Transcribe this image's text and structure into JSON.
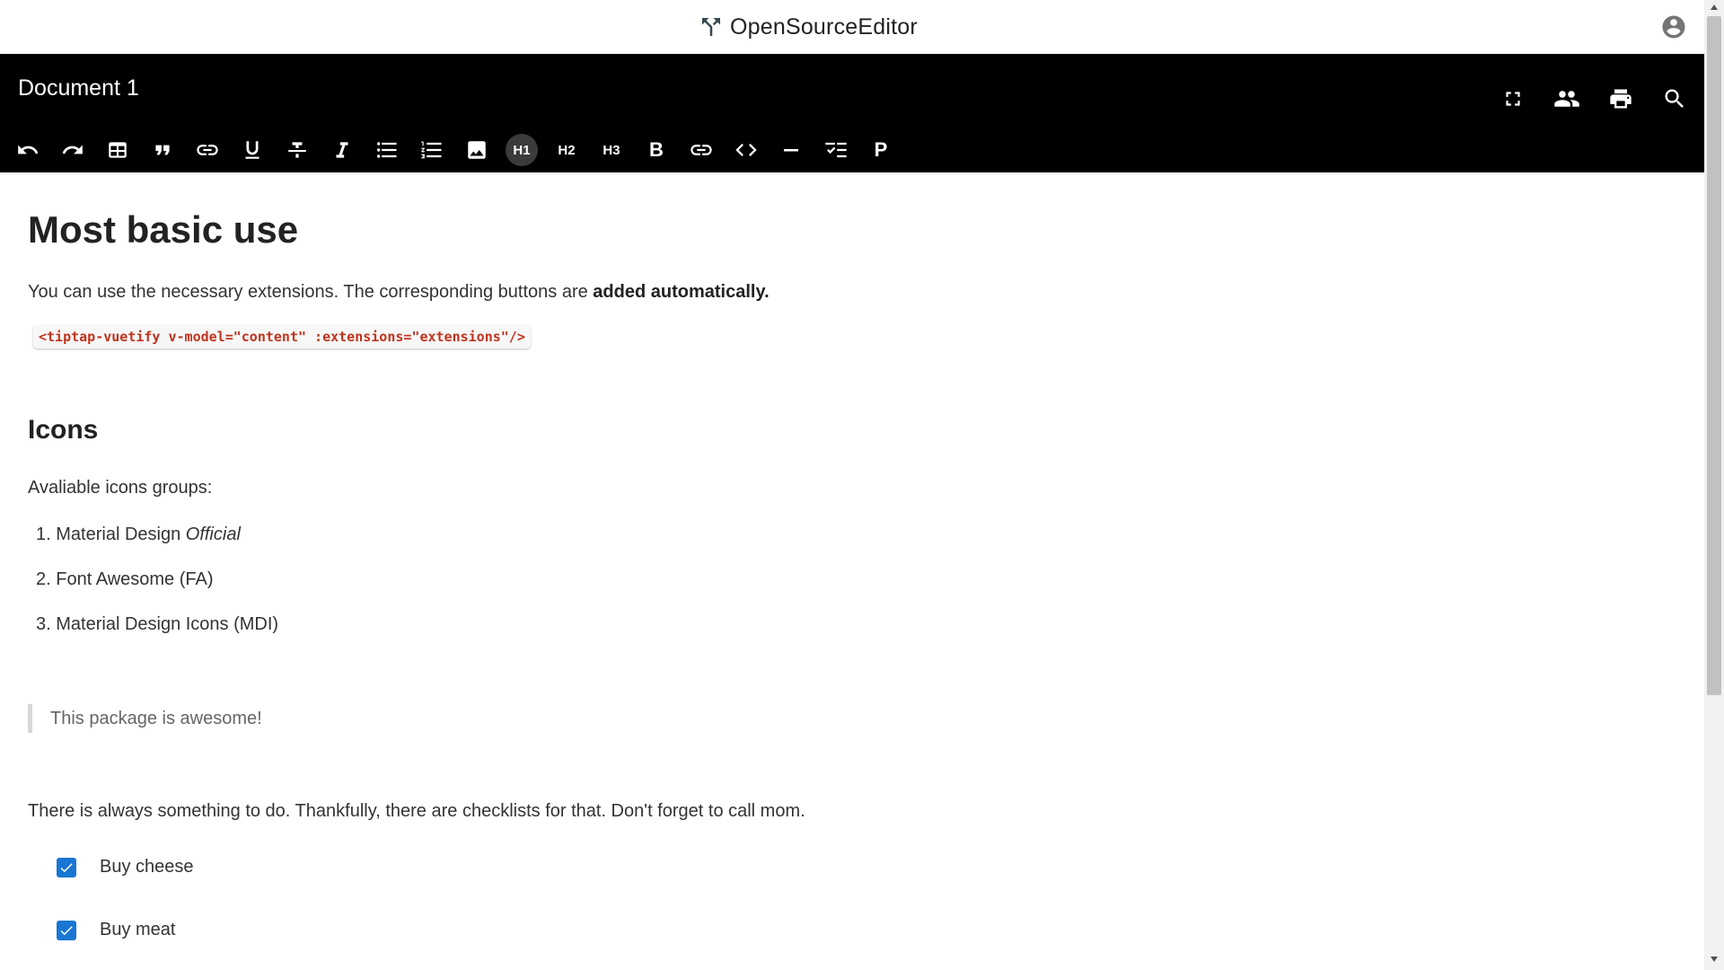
{
  "app": {
    "brand": "OpenSourceEditor"
  },
  "document": {
    "title": "Document 1"
  },
  "header_actions": [
    "fullscreen-icon",
    "collaborators-icon",
    "print-icon",
    "search-icon"
  ],
  "toolbar": {
    "h1_label": "H1",
    "h2_label": "H2",
    "h3_label": "H3",
    "bold_label": "B",
    "paragraph_label": "P",
    "active": "H1"
  },
  "content": {
    "heading1": "Most basic use",
    "intro_text": "You can use the necessary extensions. The corresponding buttons are ",
    "intro_bold": "added automatically.",
    "code": "<tiptap-vuetify v-model=\"content\" :extensions=\"extensions\"/>",
    "heading2": "Icons",
    "icons_intro": "Avaliable icons groups:",
    "list": [
      {
        "num": "1.",
        "text": "Material Design ",
        "italic": "Official"
      },
      {
        "num": "2.",
        "text": "Font Awesome (FA)",
        "italic": ""
      },
      {
        "num": "3.",
        "text": "Material Design Icons (MDI)",
        "italic": ""
      }
    ],
    "quote": "This package is awesome!",
    "checklist_intro": "There is always something to do. Thankfully, there are checklists for that. Don't forget to call mom.",
    "tasks": [
      {
        "label": "Buy cheese",
        "checked": true
      },
      {
        "label": "Buy meat",
        "checked": true
      }
    ]
  },
  "colors": {
    "header_bg": "#000000",
    "checkbox": "#1976d2",
    "code_text": "#c0341d"
  }
}
